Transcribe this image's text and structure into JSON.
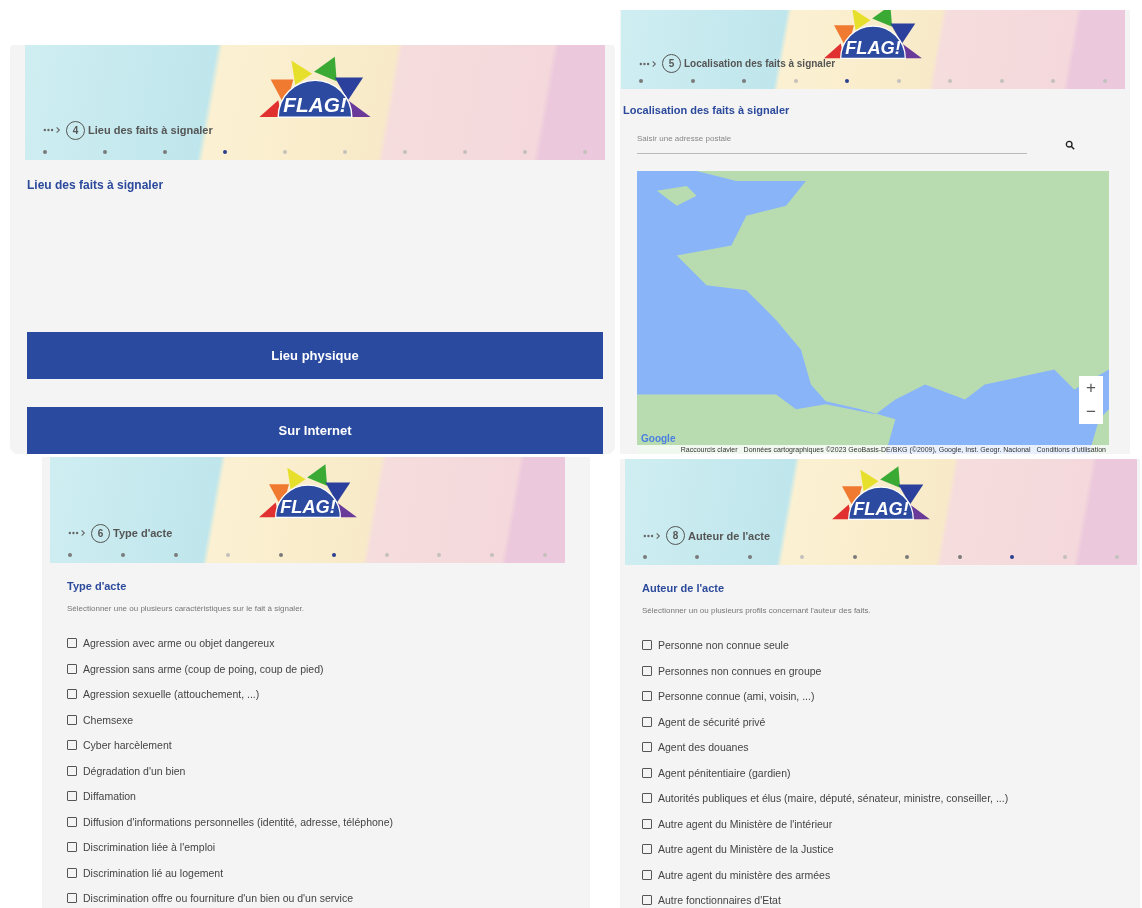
{
  "panels": [
    {
      "kind": "choice",
      "logo": "FLAG!",
      "step": "4",
      "breadcrumb": "Lieu des faits à signaler",
      "heading": "Lieu des faits à signaler",
      "dots": [
        {
          "selected": false,
          "visited": true
        },
        {
          "selected": false,
          "visited": true
        },
        {
          "selected": false,
          "visited": true
        },
        {
          "selected": true
        },
        {
          "selected": false,
          "visited": false
        },
        {
          "selected": false,
          "visited": false
        },
        {
          "selected": false,
          "visited": false
        },
        {
          "selected": false,
          "visited": false
        },
        {
          "selected": false,
          "visited": false
        },
        {
          "selected": false,
          "visited": false
        }
      ],
      "buttons": [
        "Lieu physique",
        "Sur Internet"
      ]
    },
    {
      "kind": "map",
      "logo": "FLAG!",
      "step": "5",
      "breadcrumb": "Localisation des faits à signaler",
      "heading": "Localisation des faits à signaler",
      "dots": [
        {
          "selected": false,
          "visited": true
        },
        {
          "selected": false,
          "visited": true
        },
        {
          "selected": false,
          "visited": true
        },
        {
          "selected": false,
          "visited": false
        },
        {
          "selected": true
        },
        {
          "selected": false,
          "visited": false
        },
        {
          "selected": false,
          "visited": false
        },
        {
          "selected": false,
          "visited": false
        },
        {
          "selected": false,
          "visited": false
        },
        {
          "selected": false,
          "visited": false
        }
      ],
      "search": {
        "placeholder": "Saisir une adresse postale"
      },
      "map": {
        "zoom_in": "+",
        "zoom_out": "−",
        "logo": "Google",
        "attribution": [
          "Raccourcis clavier",
          "Données cartographiques ©2023 GeoBasis-DE/BKG (©2009), Google, Inst. Geogr. Nacional",
          "Conditions d'utilisation"
        ]
      }
    },
    {
      "kind": "checklist",
      "logo": "FLAG!",
      "step": "6",
      "breadcrumb": "Type d'acte",
      "heading": "Type d'acte",
      "intro": "Sélectionner une ou plusieurs caractéristiques sur le fait à signaler.",
      "dots": [
        {
          "selected": false,
          "visited": true
        },
        {
          "selected": false,
          "visited": true
        },
        {
          "selected": false,
          "visited": true
        },
        {
          "selected": false,
          "visited": false
        },
        {
          "selected": false,
          "visited": true
        },
        {
          "selected": true
        },
        {
          "selected": false,
          "visited": false
        },
        {
          "selected": false,
          "visited": false
        },
        {
          "selected": false,
          "visited": false
        },
        {
          "selected": false,
          "visited": false
        }
      ],
      "options": [
        {
          "label": "Agression avec arme ou objet dangereux",
          "checked": false
        },
        {
          "label": "Agression sans arme (coup de poing, coup de pied)",
          "checked": false
        },
        {
          "label": "Agression sexuelle (attouchement, ...)",
          "checked": false
        },
        {
          "label": "Chemsexe",
          "checked": false
        },
        {
          "label": "Cyber harcèlement",
          "checked": false
        },
        {
          "label": "Dégradation d'un bien",
          "checked": false
        },
        {
          "label": "Diffamation",
          "checked": false
        },
        {
          "label": "Diffusion d'informations personnelles (identité, adresse, téléphone)",
          "checked": false
        },
        {
          "label": "Discrimination liée à l'emploi",
          "checked": false
        },
        {
          "label": "Discrimination lié au logement",
          "checked": false
        },
        {
          "label": "Discrimination offre ou fourniture d'un bien ou d'un service",
          "checked": false
        }
      ]
    },
    {
      "kind": "checklist",
      "logo": "FLAG!",
      "step": "8",
      "breadcrumb": "Auteur de l'acte",
      "heading": "Auteur de l'acte",
      "intro": "Sélectionner un ou plusieurs profils concernant l'auteur des faits.",
      "dots": [
        {
          "selected": false,
          "visited": true
        },
        {
          "selected": false,
          "visited": true
        },
        {
          "selected": false,
          "visited": true
        },
        {
          "selected": false,
          "visited": false
        },
        {
          "selected": false,
          "visited": true
        },
        {
          "selected": false,
          "visited": true
        },
        {
          "selected": false,
          "visited": true
        },
        {
          "selected": true
        },
        {
          "selected": false,
          "visited": false
        },
        {
          "selected": false,
          "visited": false
        }
      ],
      "options": [
        {
          "label": "Personne non connue seule",
          "checked": false
        },
        {
          "label": "Personnes non connues en groupe",
          "checked": false
        },
        {
          "label": "Personne connue (ami, voisin, ...)",
          "checked": false
        },
        {
          "label": "Agent de sécurité privé",
          "checked": false
        },
        {
          "label": "Agent des douanes",
          "checked": false
        },
        {
          "label": "Agent pénitentiaire (gardien)",
          "checked": false
        },
        {
          "label": "Autorités publiques et élus (maire, député, sénateur, ministre, conseiller, ...)",
          "checked": false
        },
        {
          "label": "Autre agent du Ministère de l'intérieur",
          "checked": false
        },
        {
          "label": "Autre agent du Ministère de la Justice",
          "checked": false
        },
        {
          "label": "Autre agent du ministère des armées",
          "checked": false
        },
        {
          "label": "Autre fonctionnaires d'Etat",
          "checked": false
        }
      ]
    }
  ]
}
